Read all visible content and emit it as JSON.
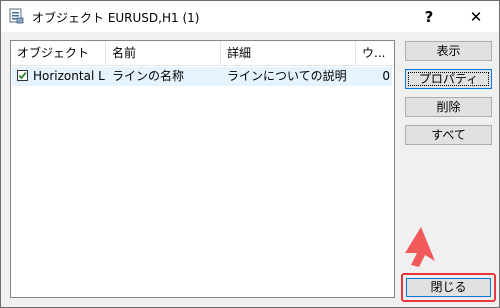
{
  "window": {
    "title": "オブジェクト EURUSD,H1 (1)",
    "help_label": "?",
    "close_label": "✕"
  },
  "list": {
    "columns": [
      "オブジェクト",
      "名前",
      "詳細",
      "ウ..."
    ],
    "rows": [
      {
        "checked": true,
        "object": "Horizontal Line",
        "name": "ラインの名称",
        "description": "ラインについての説明",
        "value": "0"
      }
    ]
  },
  "buttons": {
    "show": "表示",
    "properties": "プロパティ",
    "delete": "削除",
    "all": "すべて",
    "close": "閉じる"
  },
  "colors": {
    "highlight": "#e8383d",
    "selected_row": "#e5f3ff",
    "focus_border": "#0078d7"
  },
  "icons": {
    "app": "objects-list-icon",
    "checkbox": "checkmark-icon",
    "pointer": "red-arrow-pointer-icon"
  }
}
